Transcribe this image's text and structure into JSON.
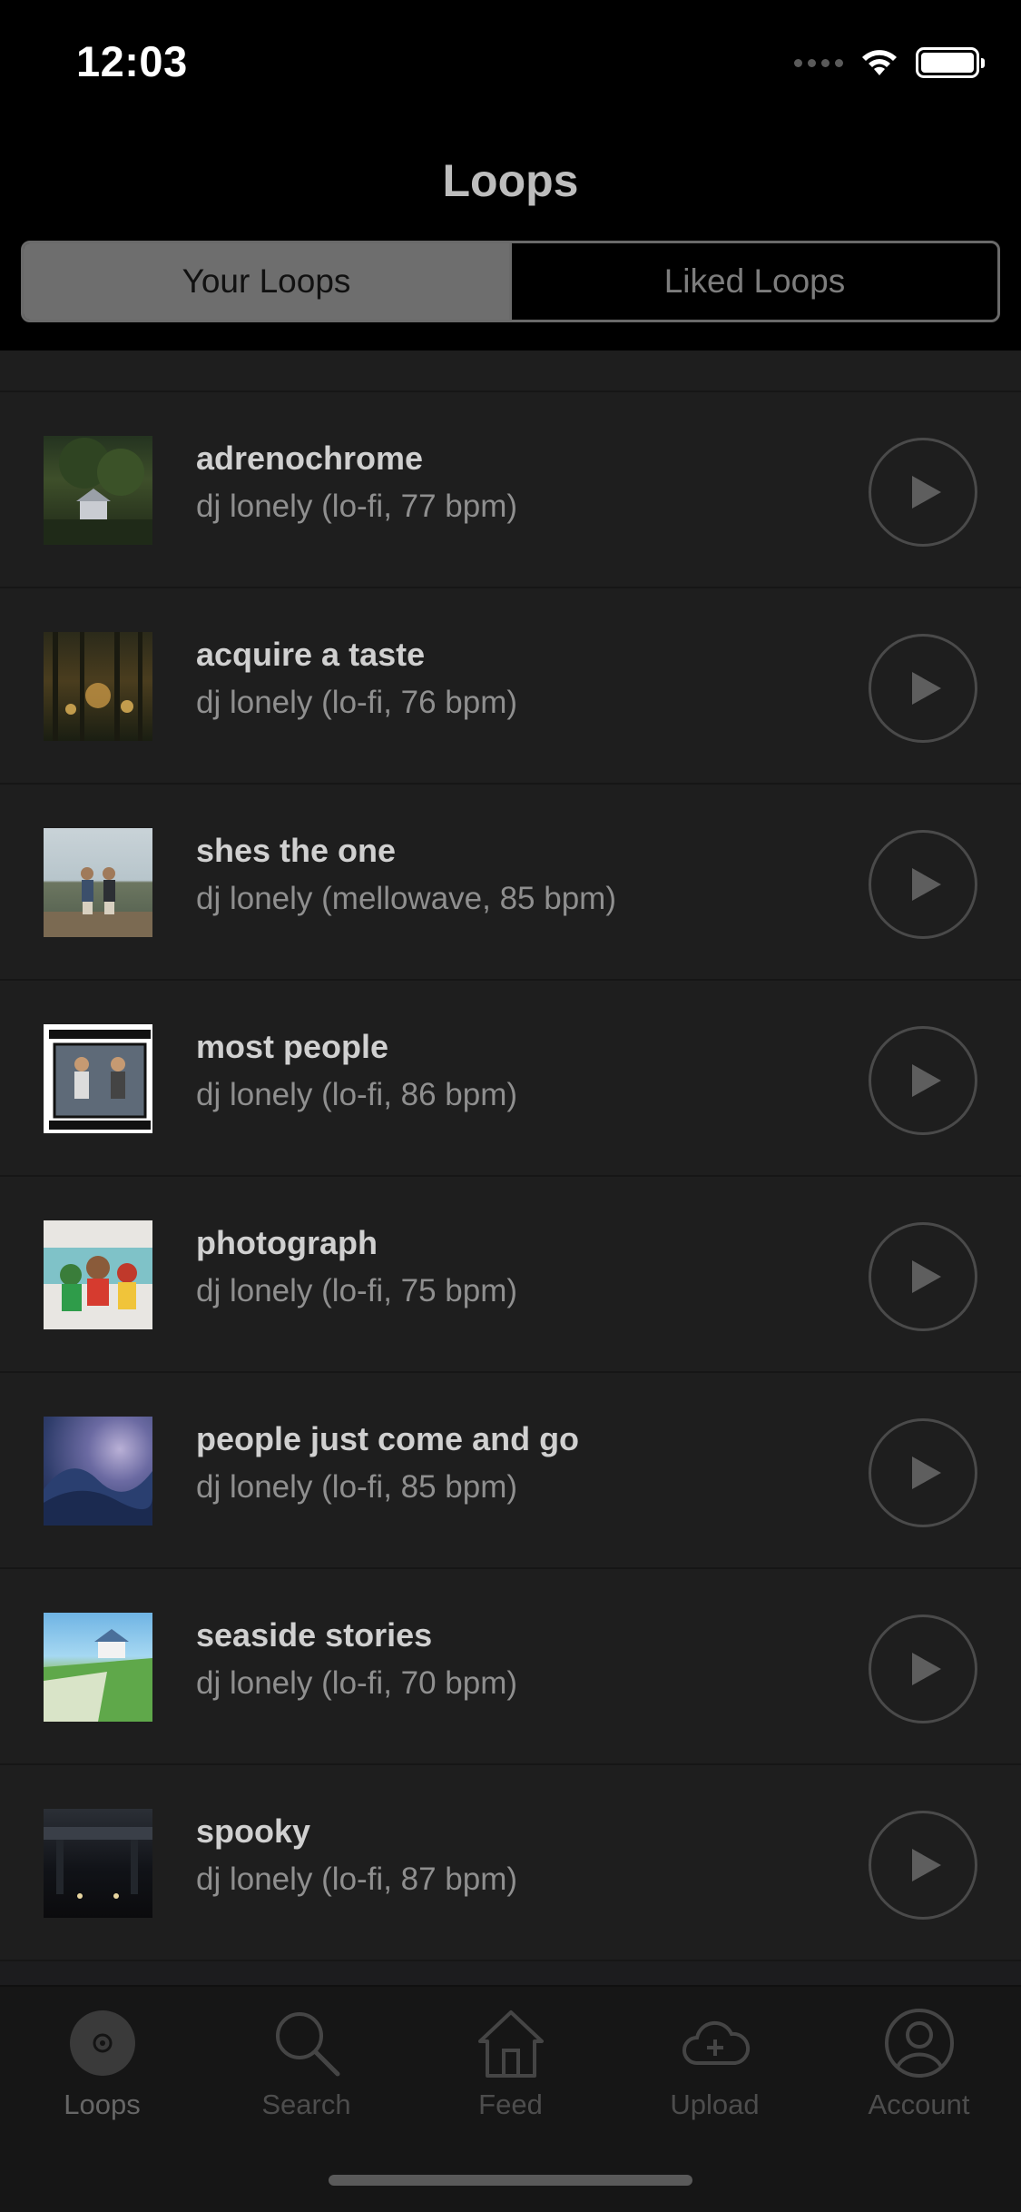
{
  "status_bar": {
    "time": "12:03"
  },
  "header": {
    "title": "Loops",
    "segments": [
      {
        "label": "Your Loops",
        "active": true
      },
      {
        "label": "Liked Loops",
        "active": false
      }
    ]
  },
  "loops": [
    {
      "title": "adrenochrome",
      "subtitle": "dj lonely (lo-fi, 77 bpm)",
      "art": "forest-cabin-artwork"
    },
    {
      "title": "acquire a taste",
      "subtitle": "dj lonely (lo-fi, 76 bpm)",
      "art": "forest-lights-artwork"
    },
    {
      "title": "shes the one",
      "subtitle": "dj lonely (mellowave, 85 bpm)",
      "art": "lake-pier-artwork"
    },
    {
      "title": "most people",
      "subtitle": "dj lonely (lo-fi, 86 bpm)",
      "art": "mellowave-volume-2-artwork"
    },
    {
      "title": "photograph",
      "subtitle": "dj lonely (lo-fi, 75 bpm)",
      "art": "cartoon-characters-artwork"
    },
    {
      "title": "people just come and go",
      "subtitle": "dj lonely (lo-fi, 85 bpm)",
      "art": "storm-wave-artwork"
    },
    {
      "title": "seaside stories",
      "subtitle": "dj lonely (lo-fi, 70 bpm)",
      "art": "seaside-cliff-house-artwork"
    },
    {
      "title": "spooky",
      "subtitle": "dj lonely (lo-fi, 87 bpm)",
      "art": "night-bridge-artwork"
    }
  ],
  "tab_bar": {
    "tabs": [
      {
        "label": "Loops",
        "icon": "loops-icon",
        "active": true
      },
      {
        "label": "Search",
        "icon": "search-icon",
        "active": false
      },
      {
        "label": "Feed",
        "icon": "home-icon",
        "active": false
      },
      {
        "label": "Upload",
        "icon": "cloud-upload-icon",
        "active": false
      },
      {
        "label": "Account",
        "icon": "person-icon",
        "active": false
      }
    ]
  },
  "colors": {
    "background": "#000000",
    "row_background": "#1e1e1e",
    "segment_active": "#6e6e6e",
    "tab_inactive": "#4d4d4d"
  }
}
